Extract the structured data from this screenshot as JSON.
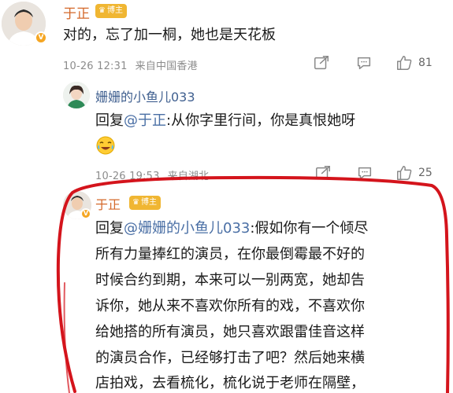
{
  "comments": [
    {
      "author": "于正",
      "author_badge": "博主",
      "verified": true,
      "text": "对的，忘了加一桐，她也是天花板",
      "meta": {
        "time": "10-26 12:31",
        "location": "来自中国香港",
        "likes": "81"
      }
    },
    {
      "author": "姗姗的小鱼儿033",
      "reply_prefix": "回复",
      "reply_to": "@于正",
      "text": ":从你字里行间，你是真恨她呀",
      "emoji": "crying-laughing",
      "meta": {
        "time": "10-26 19:53",
        "location": "来自湖北",
        "likes": "25"
      }
    },
    {
      "author": "于正",
      "author_badge": "博主",
      "reply_prefix": "回复",
      "reply_to": "@姗姗的小鱼儿033",
      "lines": [
        ":假如你有一个倾尽",
        "所有力量捧红的演员，在你最倒霉最不好的",
        "时候合约到期，本来可以一别两宽，她却告",
        "诉你，她从来不喜欢你所有的戏，不喜欢你",
        "给她搭的所有演员，她只喜欢跟雷佳音这样",
        "的演员合作，已经够打击了吧？然后她来横",
        "店拍戏，去看梳化，梳化说于老师在隔壁，"
      ]
    }
  ],
  "colors": {
    "name_orange": "#d4682a",
    "link_blue": "#4a6fa5",
    "highlight_red": "#d4141c",
    "badge_gold": "#f0b632"
  },
  "icons": [
    "share-icon",
    "comment-icon",
    "like-icon"
  ]
}
